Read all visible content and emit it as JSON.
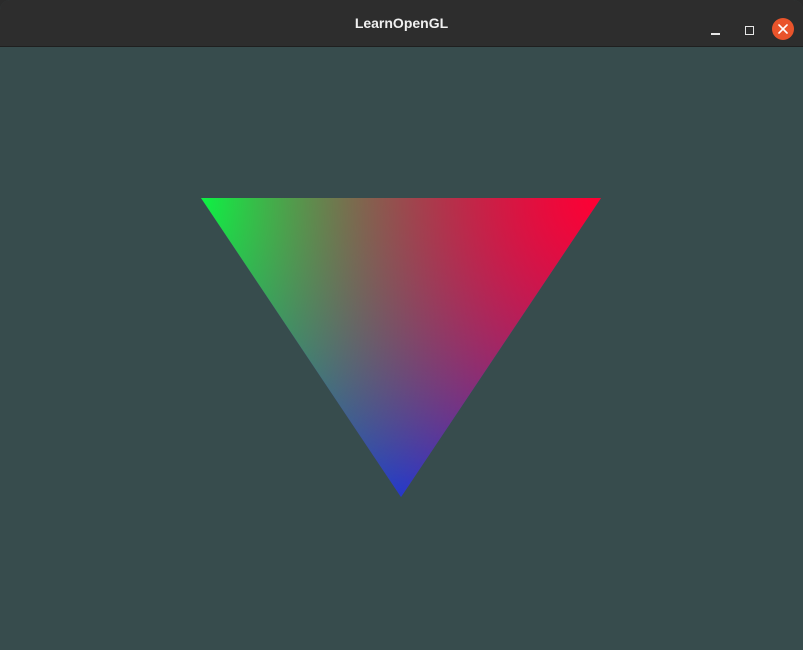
{
  "window": {
    "title": "LearnOpenGL"
  },
  "controls": {
    "minimize": "minimize-icon",
    "maximize": "maximize-icon",
    "close": "close-icon"
  },
  "colors": {
    "clear_color": "#374c4d",
    "titlebar": "#2d2d2d",
    "close_button": "#e9542b",
    "vertex_top_left": "#00ff44",
    "vertex_top_right": "#ff0033",
    "vertex_bottom": "#0022ff"
  },
  "scene": {
    "shape": "triangle",
    "vertices": [
      {
        "name": "top-left",
        "color": "#00ff44"
      },
      {
        "name": "top-right",
        "color": "#ff0033"
      },
      {
        "name": "bottom",
        "color": "#0022ff"
      }
    ]
  }
}
